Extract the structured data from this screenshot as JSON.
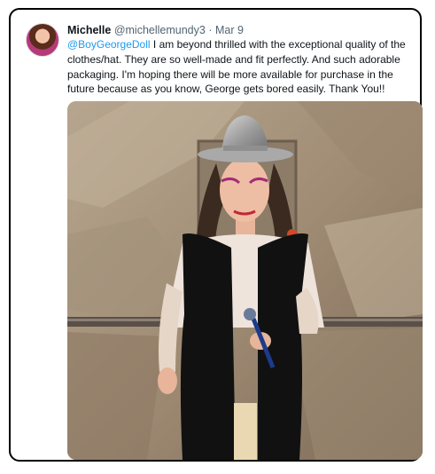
{
  "tweet": {
    "author_name": "Michelle",
    "author_handle": "@michellemundy3",
    "separator": "·",
    "date": "Mar 9",
    "mention": "@BoyGeorgeDoll",
    "text": " I am beyond thrilled with the exceptional quality of the clothes/hat. They are so well-made and fit perfectly. And such adorable packaging. I'm hoping there will be more available for purchase in the future because as you know, George gets bored easily. Thank You!!",
    "avatar": "profile-photo",
    "image": "doll-photo"
  },
  "colors": {
    "mention": "#1d9bf0",
    "secondary_text": "#536471",
    "primary_text": "#0f1419"
  }
}
